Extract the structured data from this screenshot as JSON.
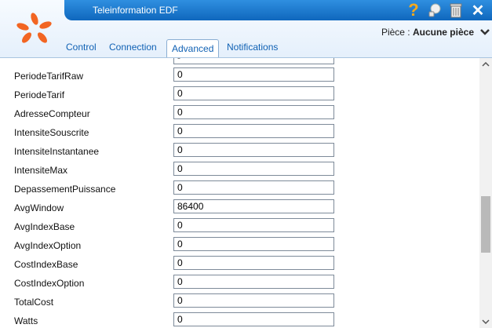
{
  "window": {
    "title": "Teleinformation EDF"
  },
  "header": {
    "piece_label": "Pièce :",
    "piece_value": "Aucune pièce",
    "icons": [
      "help-icon",
      "plugin-icon",
      "trash-icon",
      "close-icon",
      "chevron-down-icon"
    ]
  },
  "tabs": [
    {
      "label": "Control",
      "active": false
    },
    {
      "label": "Connection",
      "active": false
    },
    {
      "label": "Advanced",
      "active": true
    },
    {
      "label": "Notifications",
      "active": false
    }
  ],
  "fields": [
    {
      "label": "",
      "value": "-"
    },
    {
      "label": "PeriodeTarifRaw",
      "value": "0"
    },
    {
      "label": "PeriodeTarif",
      "value": "0"
    },
    {
      "label": "AdresseCompteur",
      "value": "0"
    },
    {
      "label": "IntensiteSouscrite",
      "value": "0"
    },
    {
      "label": "IntensiteInstantanee",
      "value": "0"
    },
    {
      "label": "IntensiteMax",
      "value": "0"
    },
    {
      "label": "DepassementPuissance",
      "value": "0"
    },
    {
      "label": "AvgWindow",
      "value": "86400"
    },
    {
      "label": "AvgIndexBase",
      "value": "0"
    },
    {
      "label": "AvgIndexOption",
      "value": "0"
    },
    {
      "label": "CostIndexBase",
      "value": "0"
    },
    {
      "label": "CostIndexOption",
      "value": "0"
    },
    {
      "label": "TotalCost",
      "value": "0"
    },
    {
      "label": "Watts",
      "value": "0"
    }
  ],
  "colors": {
    "titlebar": "#1672c8",
    "tab_text": "#1061b4",
    "logo": "#f26522"
  }
}
